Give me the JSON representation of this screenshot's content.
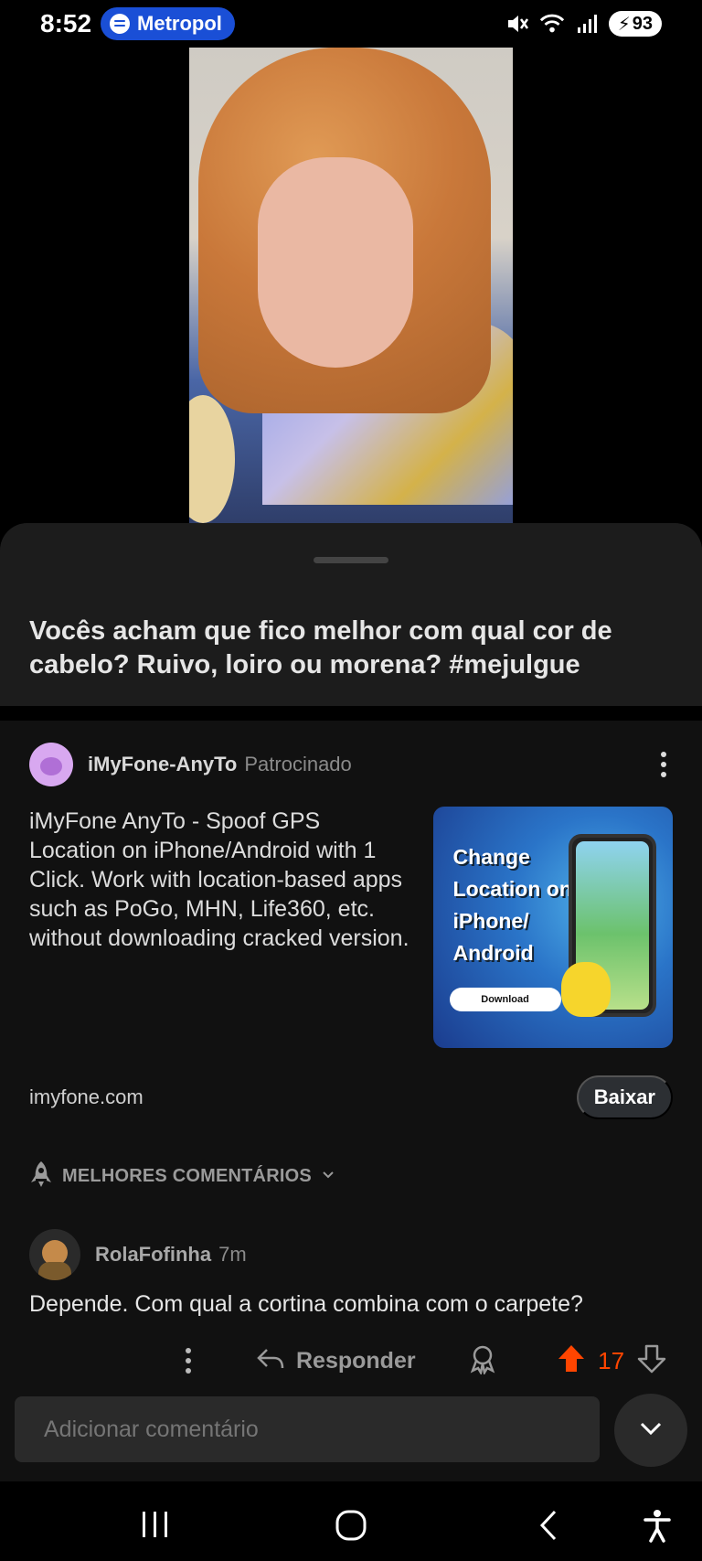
{
  "status_bar": {
    "time": "8:52",
    "media_label": "Metropol",
    "battery": "93",
    "icons": [
      "mute-icon",
      "wifi-icon",
      "signal-icon",
      "battery-icon"
    ]
  },
  "post": {
    "title": "Vocês acham que fico melhor com qual cor de cabelo? Ruivo, loiro ou morena? #mejulgue"
  },
  "ad": {
    "advertiser": "iMyFone-AnyTo",
    "sponsored_label": "Patrocinado",
    "text": "iMyFone AnyTo - Spoof GPS Location on iPhone/Android with 1 Click. Work with location-based apps such as PoGo, MHN, Life360, etc. without downloading cracked version.",
    "image_headline": [
      "Change",
      "Location on",
      "iPhone/",
      "Android"
    ],
    "image_button": "Download",
    "domain": "imyfone.com",
    "cta": "Baixar"
  },
  "comments_sort": {
    "label": "MELHORES COMENTÁRIOS"
  },
  "comments": [
    {
      "author": "RolaFofinha",
      "time": "7m",
      "body": "Depende. Com qual a cortina combina com o carpete?",
      "reply_label": "Responder",
      "score": "17"
    }
  ],
  "composer": {
    "placeholder": "Adicionar comentário"
  },
  "colors": {
    "accent_upvote": "#ff4500",
    "sheet_background": "#111111",
    "spotify_pill": "#1a4fd6"
  }
}
